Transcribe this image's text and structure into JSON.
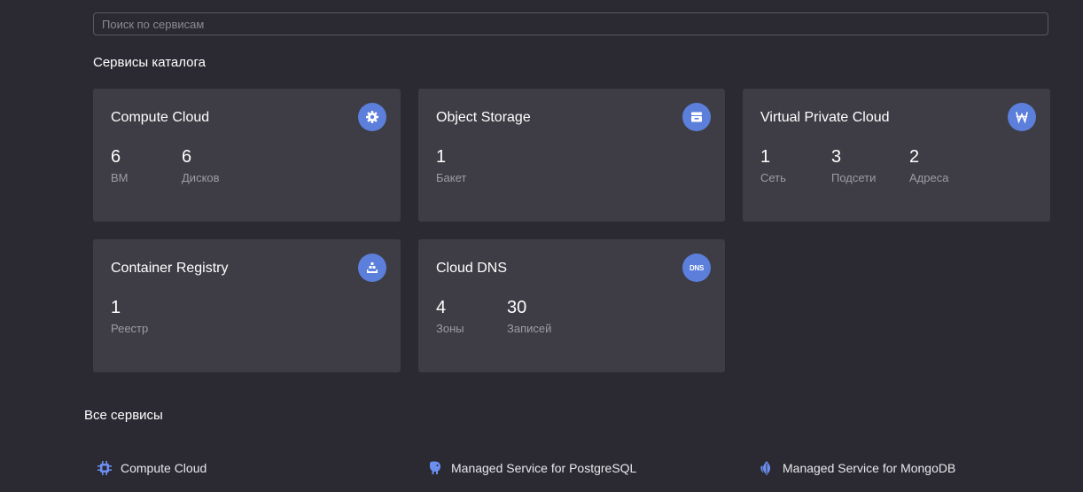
{
  "search": {
    "placeholder": "Поиск по сервисам",
    "value": ""
  },
  "catalog": {
    "title": "Сервисы каталога",
    "cards": [
      {
        "title": "Compute Cloud",
        "icon": "gear-icon",
        "stats": [
          {
            "value": "6",
            "label": "ВМ"
          },
          {
            "value": "6",
            "label": "Дисков"
          }
        ]
      },
      {
        "title": "Object Storage",
        "icon": "storage-box-icon",
        "stats": [
          {
            "value": "1",
            "label": "Бакет"
          }
        ]
      },
      {
        "title": "Virtual Private Cloud",
        "icon": "network-icon",
        "stats": [
          {
            "value": "1",
            "label": "Сеть"
          },
          {
            "value": "3",
            "label": "Подсети"
          },
          {
            "value": "2",
            "label": "Адреса"
          }
        ]
      },
      {
        "title": "Container Registry",
        "icon": "registry-icon",
        "stats": [
          {
            "value": "1",
            "label": "Реестр"
          }
        ]
      },
      {
        "title": "Cloud DNS",
        "icon": "dns-icon",
        "icon_text": "DNS",
        "stats": [
          {
            "value": "4",
            "label": "Зоны"
          },
          {
            "value": "30",
            "label": "Записей"
          }
        ]
      }
    ]
  },
  "all_services": {
    "title": "Все сервисы",
    "items": [
      {
        "label": "Compute Cloud",
        "icon": "chip-icon"
      },
      {
        "label": "Managed Service for PostgreSQL",
        "icon": "postgresql-elephant-icon"
      },
      {
        "label": "Managed Service for MongoDB",
        "icon": "mongodb-leaf-icon"
      }
    ]
  },
  "colors": {
    "background": "#2b2a33",
    "card": "#3e3d45",
    "accent": "#5b7fdb",
    "muted_text": "#9d9ca3"
  }
}
